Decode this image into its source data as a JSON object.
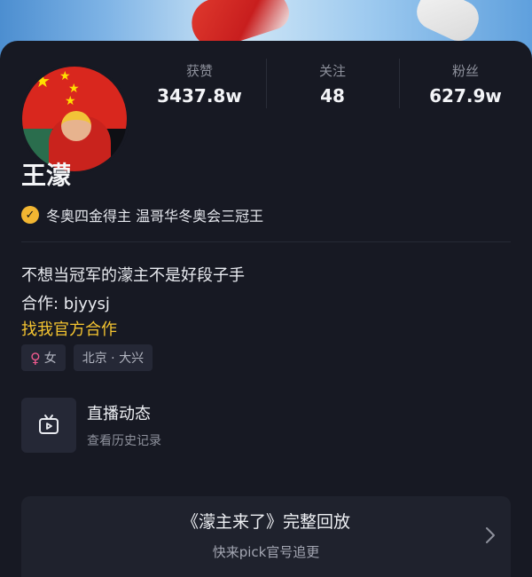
{
  "profile": {
    "name": "王濛",
    "verification": "冬奥四金得主 温哥华冬奥会三冠王"
  },
  "stats": [
    {
      "label": "获赞",
      "value": "3437.8w"
    },
    {
      "label": "关注",
      "value": "48"
    },
    {
      "label": "粉丝",
      "value": "627.9w"
    }
  ],
  "bio": {
    "line1": "不想当冠军的濛主不是好段子手",
    "line2": "合作: bjyysj",
    "business_link": "找我官方合作"
  },
  "tags": {
    "gender_icon": "female-icon",
    "gender": "女",
    "location": "北京 · 大兴"
  },
  "live": {
    "icon": "live-replay-icon",
    "title": "直播动态",
    "subtitle": "查看历史记录"
  },
  "replay": {
    "title": "《濛主来了》完整回放",
    "subtitle": "快来pick官号追更"
  },
  "colors": {
    "background": "#171923",
    "accent": "#f4c430",
    "verify_badge": "#f2b632",
    "female": "#ef5a8e"
  }
}
